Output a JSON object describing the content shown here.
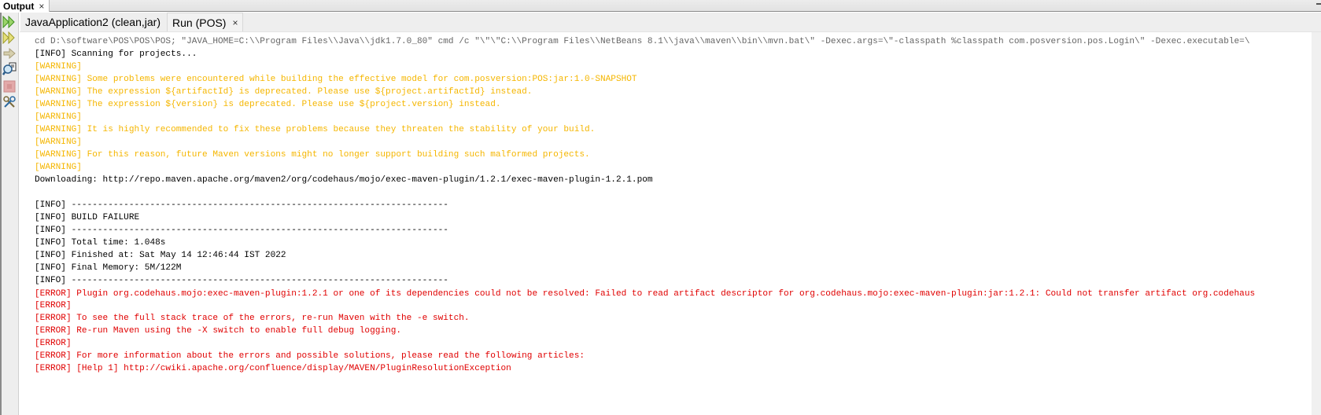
{
  "panel": {
    "title": "Output",
    "close_glyph": "×"
  },
  "tabs": [
    {
      "label": "JavaApplication2 (clean,jar)",
      "close_glyph": "×",
      "active": false
    },
    {
      "label": "Run (POS)",
      "close_glyph": "×",
      "active": true
    }
  ],
  "toolbar": [
    {
      "name": "rerun-icon",
      "title": "Re-run"
    },
    {
      "name": "rerun-with-goals-icon",
      "title": "Re-run with different parameters"
    },
    {
      "name": "resume-icon",
      "title": "Resume"
    },
    {
      "name": "inspect-icon",
      "title": "Inspect"
    },
    {
      "name": "stop-icon",
      "title": "Stop"
    },
    {
      "name": "settings-icon",
      "title": "Settings"
    }
  ],
  "colors": {
    "command": "#666666",
    "info": "#000000",
    "warning": "#f5b600",
    "error": "#e00000"
  },
  "output_lines": [
    {
      "type": "cmd",
      "text": "cd D:\\software\\POS\\POS\\POS; \"JAVA_HOME=C:\\\\Program Files\\\\Java\\\\jdk1.7.0_80\" cmd /c \"\\\"\\\"C:\\\\Program Files\\\\NetBeans 8.1\\\\java\\\\maven\\\\bin\\\\mvn.bat\\\" -Dexec.args=\\\"-classpath %classpath com.posversion.pos.Login\\\" -Dexec.executable=\\"
    },
    {
      "type": "info",
      "text": "[INFO] Scanning for projects..."
    },
    {
      "type": "warn",
      "text": "[WARNING]"
    },
    {
      "type": "warn",
      "text": "[WARNING] Some problems were encountered while building the effective model for com.posversion:POS:jar:1.0-SNAPSHOT"
    },
    {
      "type": "warn",
      "text": "[WARNING] The expression ${artifactId} is deprecated. Please use ${project.artifactId} instead."
    },
    {
      "type": "warn",
      "text": "[WARNING] The expression ${version} is deprecated. Please use ${project.version} instead."
    },
    {
      "type": "warn",
      "text": "[WARNING]"
    },
    {
      "type": "warn",
      "text": "[WARNING] It is highly recommended to fix these problems because they threaten the stability of your build."
    },
    {
      "type": "warn",
      "text": "[WARNING]"
    },
    {
      "type": "warn",
      "text": "[WARNING] For this reason, future Maven versions might no longer support building such malformed projects."
    },
    {
      "type": "warn",
      "text": "[WARNING]"
    },
    {
      "type": "info",
      "text": "Downloading: http://repo.maven.apache.org/maven2/org/codehaus/mojo/exec-maven-plugin/1.2.1/exec-maven-plugin-1.2.1.pom"
    },
    {
      "type": "info",
      "text": ""
    },
    {
      "type": "info",
      "text": "[INFO] ------------------------------------------------------------------------"
    },
    {
      "type": "info",
      "text": "[INFO] BUILD FAILURE"
    },
    {
      "type": "info",
      "text": "[INFO] ------------------------------------------------------------------------"
    },
    {
      "type": "info",
      "text": "[INFO] Total time: 1.048s"
    },
    {
      "type": "info",
      "text": "[INFO] Finished at: Sat May 14 12:46:44 IST 2022"
    },
    {
      "type": "info",
      "text": "[INFO] Final Memory: 5M/122M"
    },
    {
      "type": "info",
      "text": "[INFO] ------------------------------------------------------------------------"
    },
    {
      "type": "error",
      "text": "[ERROR] Plugin org.codehaus.mojo:exec-maven-plugin:1.2.1 or one of its dependencies could not be resolved: Failed to read artifact descriptor for org.codehaus.mojo:exec-maven-plugin:jar:1.2.1: Could not transfer artifact org.codehaus",
      "caret": true
    },
    {
      "type": "error",
      "text": "[ERROR]"
    },
    {
      "type": "error",
      "text": "[ERROR] To see the full stack trace of the errors, re-run Maven with the -e switch."
    },
    {
      "type": "error",
      "text": "[ERROR] Re-run Maven using the -X switch to enable full debug logging."
    },
    {
      "type": "error",
      "text": "[ERROR]"
    },
    {
      "type": "error",
      "text": "[ERROR] For more information about the errors and possible solutions, please read the following articles:"
    },
    {
      "type": "error",
      "text": "[ERROR] [Help 1] http://cwiki.apache.org/confluence/display/MAVEN/PluginResolutionException"
    }
  ]
}
